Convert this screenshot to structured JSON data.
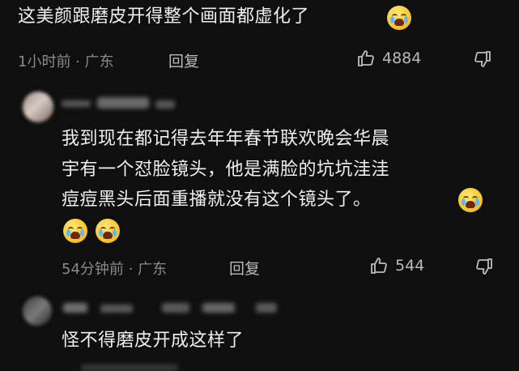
{
  "comment1": {
    "text": "这美颜跟磨皮开得整个画面都虚化了",
    "emoji": "cry-laugh-emoji",
    "time": "1小时前 · 广东",
    "reply_label": "回复",
    "likes": "4884"
  },
  "comment2": {
    "text_line1": "我到现在都记得去年年春节联欢晚会华晨",
    "text_line2": "宇有一个怼脸镜头，他是满脸的坑坑洼洼",
    "text_line3": "痘痘黑头后面重播就没有这个镜头了。",
    "emoji": "cry-laugh-emoji",
    "time": "54分钟前 · 广东",
    "reply_label": "回复",
    "likes": "544"
  },
  "comment3": {
    "text": "怪不得磨皮开成这样了"
  },
  "icons": {
    "like": "thumbs-up-icon",
    "dislike": "thumbs-down-icon"
  }
}
